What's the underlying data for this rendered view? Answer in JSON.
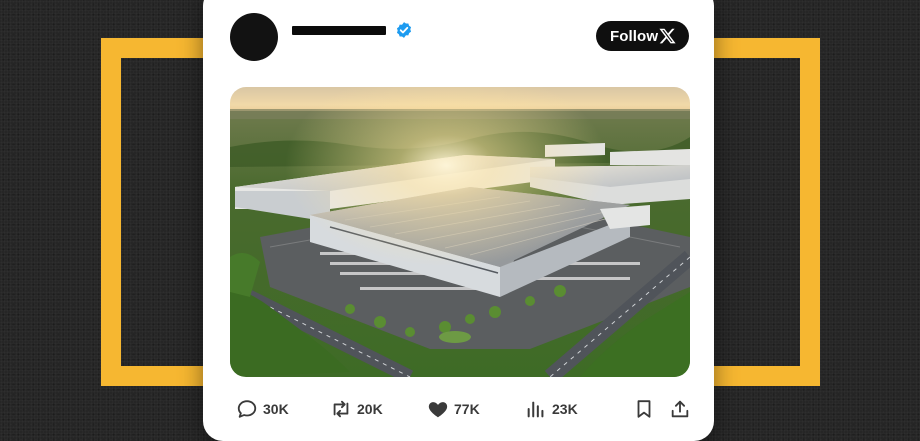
{
  "follow": {
    "label": "Follow",
    "icon": "x-logo-icon"
  },
  "verified_badge": {
    "icon": "verified-badge-icon",
    "color": "#1d9bf0"
  },
  "frame": {
    "color": "#f6b731"
  },
  "actions": {
    "replies": {
      "count": "30K",
      "icon": "reply-icon"
    },
    "reposts": {
      "count": "20K",
      "icon": "repost-icon"
    },
    "likes": {
      "count": "77K",
      "icon": "heart-icon"
    },
    "views": {
      "count": "23K",
      "icon": "views-icon"
    },
    "bookmark": {
      "icon": "bookmark-icon"
    },
    "share": {
      "icon": "share-icon"
    }
  }
}
